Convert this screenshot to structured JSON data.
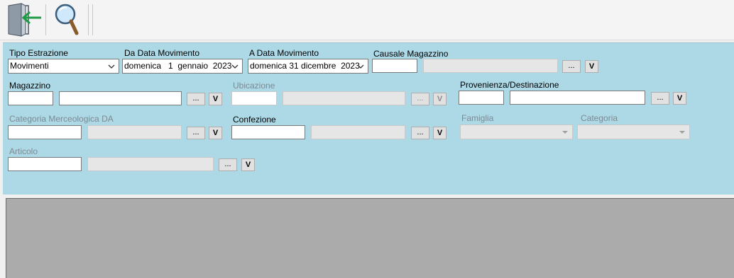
{
  "toolbar": {
    "exit_icon": "exit-door-icon",
    "search_icon": "search-icon"
  },
  "filters": {
    "tipo_estrazione": {
      "label": "Tipo Estrazione",
      "value": "Movimenti"
    },
    "da_data": {
      "label": "Da Data Movimento",
      "value": "domenica   1  gennaio  2023"
    },
    "a_data": {
      "label": "A Data Movimento",
      "value": "domenica 31 dicembre  2023"
    },
    "causale": {
      "label": "Causale Magazzino",
      "code": "",
      "description": ""
    },
    "magazzino": {
      "label": "Magazzino",
      "code": "",
      "description": ""
    },
    "ubicazione": {
      "label": "Ubicazione",
      "code": "",
      "description": ""
    },
    "provenienza": {
      "label": "Provenienza/Destinazione",
      "code": "",
      "description": ""
    },
    "categoria_merc": {
      "label": "Categoria Merceologica DA",
      "code": "",
      "description": ""
    },
    "confezione": {
      "label": "Confezione",
      "code": "",
      "description": ""
    },
    "famiglia": {
      "label": "Famiglia",
      "value": ""
    },
    "categoria": {
      "label": "Categoria",
      "value": ""
    },
    "articolo": {
      "label": "Articolo",
      "code": "",
      "description": ""
    }
  },
  "buttons": {
    "lookup": "...",
    "v": "V"
  },
  "colors": {
    "panel": "#add8e6",
    "grid": "#ababab",
    "toolbar": "#f4f4f4"
  }
}
